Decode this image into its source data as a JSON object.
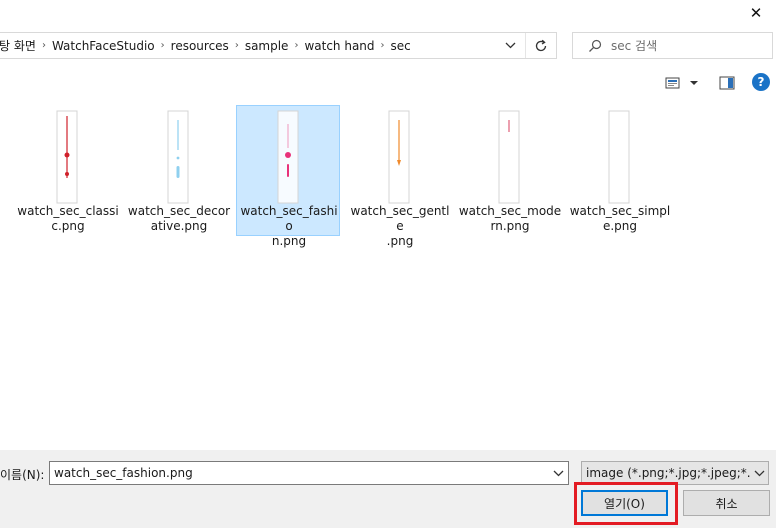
{
  "window": {
    "close_glyph": "✕"
  },
  "address": {
    "crumbs": [
      "탕 화면",
      "WatchFaceStudio",
      "resources",
      "sample",
      "watch hand",
      "sec"
    ],
    "separator": "›"
  },
  "search": {
    "placeholder": "sec 검색"
  },
  "toolbar": {
    "help_glyph": "?"
  },
  "files": [
    {
      "name": "watch_sec_classic.png",
      "label_lines": [
        "watch_sec_classi",
        "c.png"
      ],
      "selected": false,
      "hand_color": "#d0202a",
      "style": "classic"
    },
    {
      "name": "watch_sec_decorative.png",
      "label_lines": [
        "watch_sec_decor",
        "ative.png"
      ],
      "selected": false,
      "hand_color": "#8fd0ef",
      "style": "decorative"
    },
    {
      "name": "watch_sec_fashion.png",
      "label_lines": [
        "watch_sec_fashio",
        "n.png"
      ],
      "selected": true,
      "hand_color": "#e8327a",
      "style": "fashion"
    },
    {
      "name": "watch_sec_gentle.png",
      "label_lines": [
        "watch_sec_gentle",
        ".png"
      ],
      "selected": false,
      "hand_color": "#f08a2c",
      "style": "gentle"
    },
    {
      "name": "watch_sec_modern.png",
      "label_lines": [
        "watch_sec_mode",
        "rn.png"
      ],
      "selected": false,
      "hand_color": "#e0607a",
      "style": "modern"
    },
    {
      "name": "watch_sec_simple.png",
      "label_lines": [
        "watch_sec_simpl",
        "e.png"
      ],
      "selected": false,
      "hand_color": "#f4f4f4",
      "style": "simple"
    }
  ],
  "filename": {
    "label": "이름(N):",
    "value": "watch_sec_fashion.png"
  },
  "filter": {
    "selected": "image (*.png;*.jpg;*.jpeg;*.jfif;*"
  },
  "buttons": {
    "open": "열기(O)",
    "cancel": "취소"
  },
  "colors": {
    "selection_bg": "#cce8ff",
    "selection_border": "#99d1ff",
    "accent": "#0078d7",
    "annotation_red": "#e31b23",
    "help_blue": "#1a73c7"
  }
}
